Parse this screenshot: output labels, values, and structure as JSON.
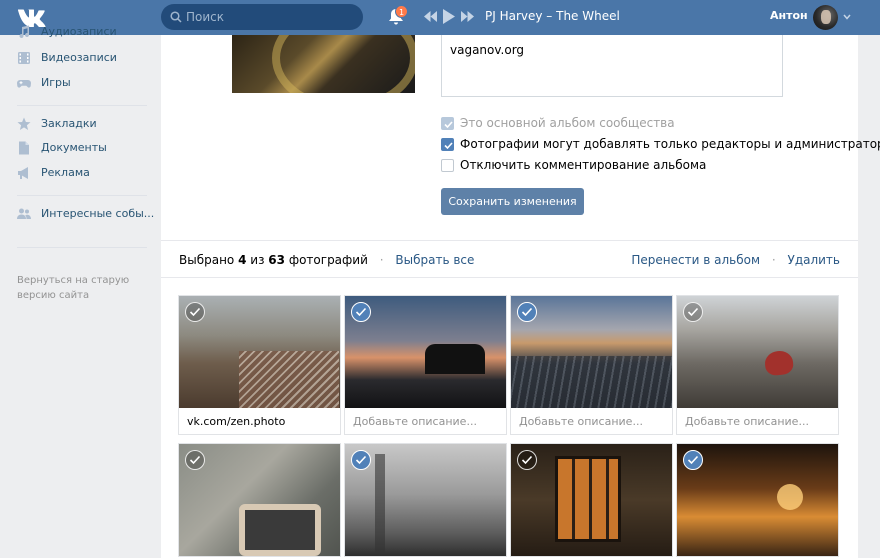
{
  "header": {
    "search_placeholder": "Поиск",
    "notifications_count": "1",
    "track": "PJ Harvey – The Wheel",
    "user_name": "Антон",
    "brand_color": "#4a76a8"
  },
  "sidebar": {
    "items": [
      {
        "label": "Аудиозаписи",
        "icon": "music-icon"
      },
      {
        "label": "Видеозаписи",
        "icon": "video-icon"
      },
      {
        "label": "Игры",
        "icon": "gamepad-icon"
      },
      {
        "label": "Закладки",
        "icon": "star-icon"
      },
      {
        "label": "Документы",
        "icon": "document-icon"
      },
      {
        "label": "Реклама",
        "icon": "megaphone-icon"
      },
      {
        "label": "Интересные собы...",
        "icon": "users-icon"
      }
    ],
    "footer": "Вернуться на старую версию сайта"
  },
  "album": {
    "description": "vaganov.org",
    "options": [
      {
        "label": "Это основной альбом сообщества",
        "checked": true,
        "disabled": true
      },
      {
        "label": "Фотографии могут добавлять только редакторы и администраторы",
        "checked": true,
        "disabled": false
      },
      {
        "label": "Отключить комментирование альбома",
        "checked": false,
        "disabled": false
      }
    ],
    "save_label": "Сохранить изменения"
  },
  "selection": {
    "prefix": "Выбрано",
    "selected": "4",
    "of": "из",
    "total": "63",
    "suffix": "фотографий",
    "select_all": "Выбрать все",
    "move": "Перенести в альбом",
    "delete": "Удалить"
  },
  "photos": [
    {
      "caption": "vk.com/zen.photo",
      "placeholder": false,
      "selected": false
    },
    {
      "caption": "Добавьте описание...",
      "placeholder": true,
      "selected": true
    },
    {
      "caption": "Добавьте описание...",
      "placeholder": true,
      "selected": true
    },
    {
      "caption": "Добавьте описание...",
      "placeholder": true,
      "selected": false
    },
    {
      "caption": "",
      "placeholder": false,
      "selected": false
    },
    {
      "caption": "",
      "placeholder": false,
      "selected": true
    },
    {
      "caption": "",
      "placeholder": false,
      "selected": false
    },
    {
      "caption": "",
      "placeholder": false,
      "selected": true
    }
  ]
}
